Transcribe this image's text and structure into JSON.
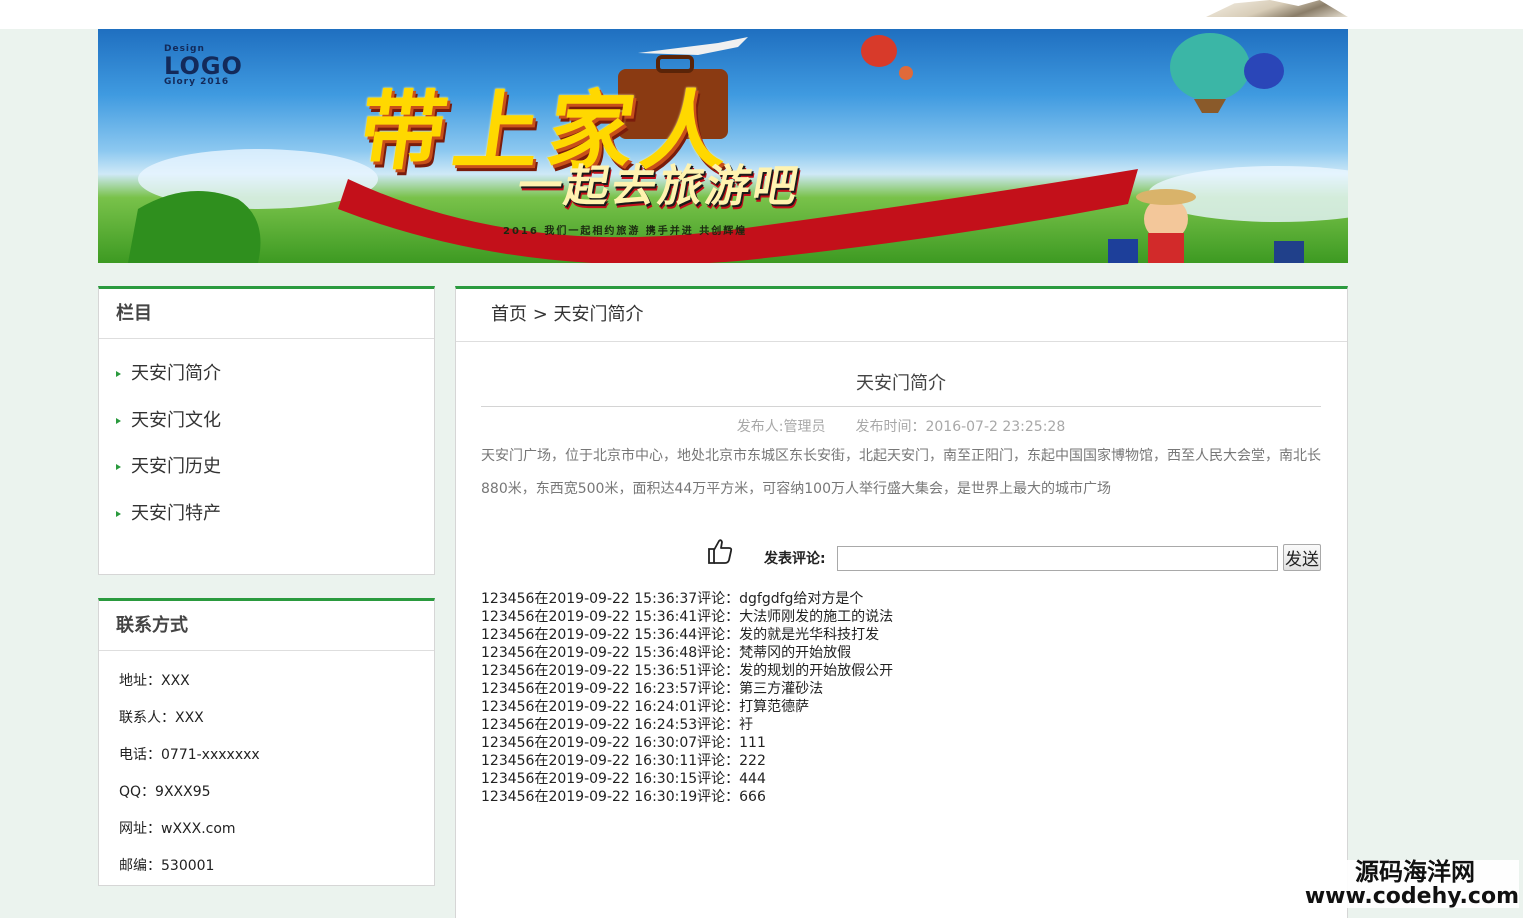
{
  "banner": {
    "logo_small_top": "Design",
    "logo_text": "LOGO",
    "logo_small_bottom": "Glory 2016",
    "headline": "带上家人",
    "subheadline": "一起去旅游吧",
    "tagline": "2016 我们一起相约旅游 携手并进 共创辉煌"
  },
  "nav": {
    "title": "栏目",
    "items": [
      {
        "label": "天安门简介"
      },
      {
        "label": "天安门文化"
      },
      {
        "label": "天安门历史"
      },
      {
        "label": "天安门特产"
      }
    ]
  },
  "contact": {
    "title": "联系方式",
    "rows": [
      {
        "text": "地址：XXX"
      },
      {
        "text": "联系人：XXX"
      },
      {
        "text": "电话：0771-xxxxxxx"
      },
      {
        "text": "QQ：9XXX95"
      },
      {
        "text": "网址：wXXX.com"
      },
      {
        "text": "邮编：530001"
      }
    ]
  },
  "breadcrumb": {
    "home": "首页",
    "separator": " > ",
    "current": "天安门简介"
  },
  "article": {
    "title": "天安门简介",
    "author": "发布人:管理员",
    "published": "发布时间：2016-07-2 23:25:28",
    "body": "天安门广场，位于北京市中心，地处北京市东城区东长安街，北起天安门，南至正阳门，东起中国国家博物馆，西至人民大会堂，南北长880米，东西宽500米，面积达44万平方米，可容纳100万人举行盛大集会，是世界上最大的城市广场"
  },
  "comment_form": {
    "like_icon": "thumbs-up-icon",
    "label": "发表评论:",
    "input_value": "",
    "input_placeholder": "",
    "send_label": "发送"
  },
  "comments": [
    {
      "text": "123456在2019-09-22 15:36:37评论：dgfgdfg给对方是个"
    },
    {
      "text": "123456在2019-09-22 15:36:41评论：大法师刚发的施工的说法"
    },
    {
      "text": "123456在2019-09-22 15:36:44评论：发的就是光华科技打发"
    },
    {
      "text": "123456在2019-09-22 15:36:48评论：梵蒂冈的开始放假"
    },
    {
      "text": "123456在2019-09-22 15:36:51评论：发的规划的开始放假公开"
    },
    {
      "text": "123456在2019-09-22 16:23:57评论：第三方灌砂法"
    },
    {
      "text": "123456在2019-09-22 16:24:01评论：打算范德萨"
    },
    {
      "text": "123456在2019-09-22 16:24:53评论：衧"
    },
    {
      "text": "123456在2019-09-22 16:30:07评论：111"
    },
    {
      "text": "123456在2019-09-22 16:30:11评论：222"
    },
    {
      "text": "123456在2019-09-22 16:30:15评论：444"
    },
    {
      "text": "123456在2019-09-22 16:30:19评论：666"
    }
  ],
  "watermark": {
    "name": "源码海洋网",
    "url": "www.codehy.com"
  },
  "colors": {
    "accent": "#2a9a3e",
    "page_background": "#ebf3ee"
  }
}
